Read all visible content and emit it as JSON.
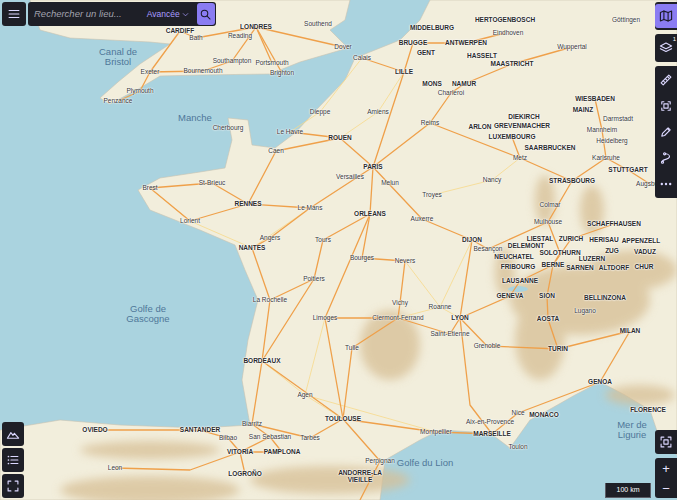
{
  "search": {
    "placeholder": "Rechercher un lieu...",
    "mode": "Avancée"
  },
  "toolbar": [
    {
      "kind": "map",
      "selected": true
    },
    {
      "kind": "layers",
      "selected": false,
      "badge": "1"
    },
    {
      "kind": "ruler",
      "selected": false
    },
    {
      "kind": "area",
      "selected": false
    },
    {
      "kind": "pencil",
      "selected": false
    },
    {
      "kind": "route",
      "selected": false
    },
    {
      "kind": "more",
      "selected": false
    }
  ],
  "side_buttons": [
    {
      "kind": "terrain"
    },
    {
      "kind": "legend"
    },
    {
      "kind": "select"
    }
  ],
  "controls": {
    "zoom_in": "+",
    "zoom_out": "−"
  },
  "scale": "100 km",
  "labels": [
    {
      "text": "CARDIFF",
      "kind": "city"
    },
    {
      "text": "LONDRES",
      "kind": "city"
    },
    {
      "text": "Southend",
      "kind": "town"
    },
    {
      "text": "Bath",
      "kind": "town"
    },
    {
      "text": "Reading",
      "kind": "town"
    },
    {
      "text": "Canal de Bristol",
      "kind": "sea"
    },
    {
      "text": "Exeter",
      "kind": "town"
    },
    {
      "text": "Southampton",
      "kind": "town"
    },
    {
      "text": "Portsmouth",
      "kind": "town"
    },
    {
      "text": "Bournemouth",
      "kind": "town"
    },
    {
      "text": "Brighton",
      "kind": "town"
    },
    {
      "text": "Dover",
      "kind": "town"
    },
    {
      "text": "Plymouth",
      "kind": "town"
    },
    {
      "text": "Penzance",
      "kind": "town"
    },
    {
      "text": "Manche",
      "kind": "sea"
    },
    {
      "text": "Cherbourg",
      "kind": "town"
    },
    {
      "text": "Dieppe",
      "kind": "town"
    },
    {
      "text": "Le Havre",
      "kind": "town"
    },
    {
      "text": "ROUEN",
      "kind": "city"
    },
    {
      "text": "Amiens",
      "kind": "town"
    },
    {
      "text": "Calais",
      "kind": "town"
    },
    {
      "text": "LILLE",
      "kind": "city"
    },
    {
      "text": "MIDDELBURG",
      "kind": "city"
    },
    {
      "text": "BRUGGE",
      "kind": "city"
    },
    {
      "text": "GENT",
      "kind": "city"
    },
    {
      "text": "ANTWERPEN",
      "kind": "city"
    },
    {
      "text": "HERTOGENBOSCH",
      "kind": "city"
    },
    {
      "text": "Eindhoven",
      "kind": "town"
    },
    {
      "text": "HASSELT",
      "kind": "city"
    },
    {
      "text": "MAASTRICHT",
      "kind": "city"
    },
    {
      "text": "Wuppertal",
      "kind": "town"
    },
    {
      "text": "Göttingen",
      "kind": "town"
    },
    {
      "text": "MONS",
      "kind": "city"
    },
    {
      "text": "NAMUR",
      "kind": "city"
    },
    {
      "text": "Charleroi",
      "kind": "town"
    },
    {
      "text": "Reims",
      "kind": "town"
    },
    {
      "text": "DIEKIRCH",
      "kind": "city"
    },
    {
      "text": "GREVENMACHER",
      "kind": "city"
    },
    {
      "text": "ARLON",
      "kind": "city"
    },
    {
      "text": "LUXEMBOURG",
      "kind": "city"
    },
    {
      "text": "WIESBADEN",
      "kind": "city"
    },
    {
      "text": "MAINZ",
      "kind": "city"
    },
    {
      "text": "Darmstadt",
      "kind": "town"
    },
    {
      "text": "Mannheim",
      "kind": "town"
    },
    {
      "text": "Heidelberg",
      "kind": "town"
    },
    {
      "text": "SAARBRUCKEN",
      "kind": "city"
    },
    {
      "text": "Metz",
      "kind": "town"
    },
    {
      "text": "Karlsruhe",
      "kind": "town"
    },
    {
      "text": "STUTTGART",
      "kind": "city"
    },
    {
      "text": "PARIS",
      "kind": "city"
    },
    {
      "text": "Versailles",
      "kind": "town"
    },
    {
      "text": "Melun",
      "kind": "town"
    },
    {
      "text": "Troyes",
      "kind": "town"
    },
    {
      "text": "Caen",
      "kind": "town"
    },
    {
      "text": "Brest",
      "kind": "town"
    },
    {
      "text": "St-Brieuc",
      "kind": "town"
    },
    {
      "text": "RENNES",
      "kind": "city"
    },
    {
      "text": "Le Mans",
      "kind": "town"
    },
    {
      "text": "ORLEANS",
      "kind": "city"
    },
    {
      "text": "Auxerre",
      "kind": "town"
    },
    {
      "text": "Nancy",
      "kind": "town"
    },
    {
      "text": "STRASBOURG",
      "kind": "city"
    },
    {
      "text": "Colmar",
      "kind": "town"
    },
    {
      "text": "Mulhouse",
      "kind": "town"
    },
    {
      "text": "SCHAFFHAUSEN",
      "kind": "city"
    },
    {
      "text": "Augsburg",
      "kind": "town"
    },
    {
      "text": "Lorient",
      "kind": "town"
    },
    {
      "text": "Angers",
      "kind": "town"
    },
    {
      "text": "NANTES",
      "kind": "city"
    },
    {
      "text": "Tours",
      "kind": "town"
    },
    {
      "text": "DIJON",
      "kind": "city"
    },
    {
      "text": "Besançon",
      "kind": "town"
    },
    {
      "text": "LIESTAL",
      "kind": "city"
    },
    {
      "text": "ZURICH",
      "kind": "city"
    },
    {
      "text": "HERISAU",
      "kind": "city"
    },
    {
      "text": "APPENZELL",
      "kind": "city"
    },
    {
      "text": "DELEMONT",
      "kind": "city"
    },
    {
      "text": "SOLOTHURN",
      "kind": "city"
    },
    {
      "text": "ZUG",
      "kind": "city"
    },
    {
      "text": "VADUZ",
      "kind": "city"
    },
    {
      "text": "NEUCHATEL",
      "kind": "city"
    },
    {
      "text": "LUZERN",
      "kind": "city"
    },
    {
      "text": "FRIBOURG",
      "kind": "city"
    },
    {
      "text": "BERNE",
      "kind": "city"
    },
    {
      "text": "SARNEN",
      "kind": "city"
    },
    {
      "text": "ALTDORF",
      "kind": "city"
    },
    {
      "text": "CHUR",
      "kind": "city"
    },
    {
      "text": "Bourges",
      "kind": "town"
    },
    {
      "text": "Nevers",
      "kind": "town"
    },
    {
      "text": "Poitiers",
      "kind": "town"
    },
    {
      "text": "LAUSANNE",
      "kind": "city"
    },
    {
      "text": "GENEVA",
      "kind": "city"
    },
    {
      "text": "SION",
      "kind": "city"
    },
    {
      "text": "BELLINZONA",
      "kind": "city"
    },
    {
      "text": "La Rochelle",
      "kind": "town"
    },
    {
      "text": "Vichy",
      "kind": "town"
    },
    {
      "text": "Roanne",
      "kind": "town"
    },
    {
      "text": "Lugano",
      "kind": "town"
    },
    {
      "text": "Limoges",
      "kind": "town"
    },
    {
      "text": "Clermont-Ferrand",
      "kind": "town"
    },
    {
      "text": "LYON",
      "kind": "city"
    },
    {
      "text": "AOSTA",
      "kind": "city"
    },
    {
      "text": "MILAN",
      "kind": "city"
    },
    {
      "text": "Saint-Etienne",
      "kind": "town"
    },
    {
      "text": "Grenoble",
      "kind": "town"
    },
    {
      "text": "TURIN",
      "kind": "city"
    },
    {
      "text": "Golfe de Gascogne",
      "kind": "sea"
    },
    {
      "text": "BORDEAUX",
      "kind": "city"
    },
    {
      "text": "Tulle",
      "kind": "town"
    },
    {
      "text": "GENOA",
      "kind": "city"
    },
    {
      "text": "Agen",
      "kind": "town"
    },
    {
      "text": "FLORENCE",
      "kind": "city"
    },
    {
      "text": "Nice",
      "kind": "town"
    },
    {
      "text": "MONACO",
      "kind": "city"
    },
    {
      "text": "Mer de Ligurie",
      "kind": "sea"
    },
    {
      "text": "TOULOUSE",
      "kind": "city"
    },
    {
      "text": "Aix-en-Provence",
      "kind": "town"
    },
    {
      "text": "Montpellier",
      "kind": "town"
    },
    {
      "text": "MARSEILLE",
      "kind": "city"
    },
    {
      "text": "Toulon",
      "kind": "town"
    },
    {
      "text": "Biarritz",
      "kind": "town"
    },
    {
      "text": "SANTANDER",
      "kind": "city"
    },
    {
      "text": "OVIEDO",
      "kind": "city"
    },
    {
      "text": "Bilbao",
      "kind": "town"
    },
    {
      "text": "San Sebastian",
      "kind": "town"
    },
    {
      "text": "Tarbes",
      "kind": "town"
    },
    {
      "text": "VITORIA",
      "kind": "city"
    },
    {
      "text": "PAMPLONA",
      "kind": "city"
    },
    {
      "text": "LOGROÑO",
      "kind": "city"
    },
    {
      "text": "Leon",
      "kind": "town"
    },
    {
      "text": "Perpignan",
      "kind": "town"
    },
    {
      "text": "ANDORRE-LA VIEILLE",
      "kind": "city"
    },
    {
      "text": "Golfe du Lion",
      "kind": "sea"
    }
  ]
}
